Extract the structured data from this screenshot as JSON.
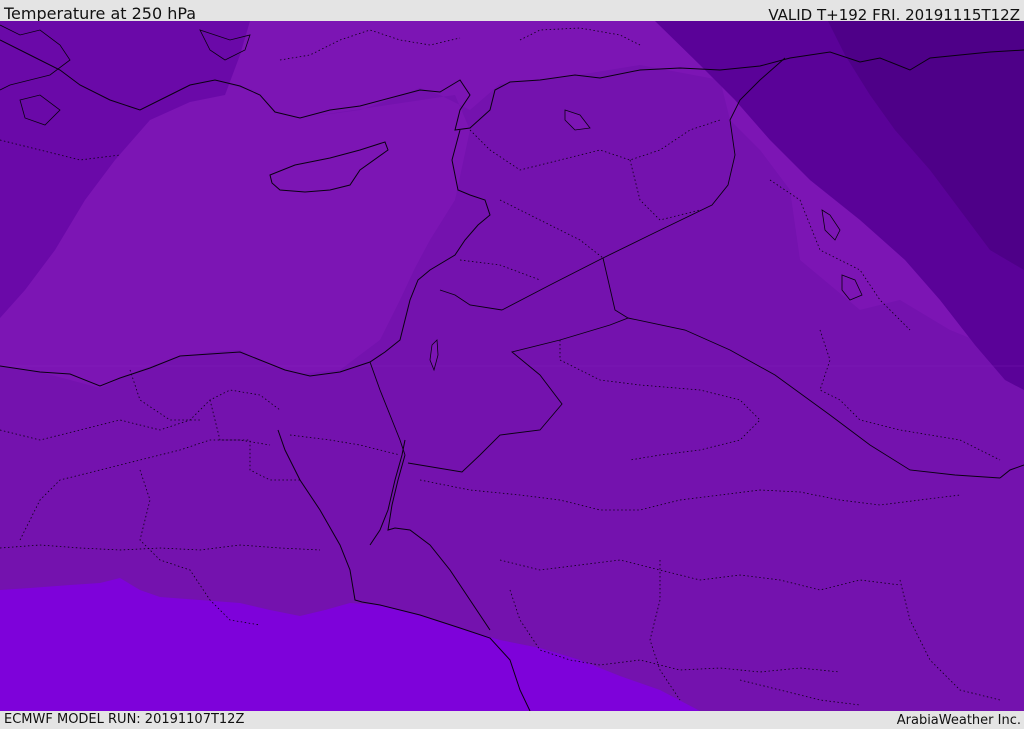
{
  "header": {
    "title": "Temperature at 250 hPa",
    "valid": "VALID T+192 FRI. 20191115T12Z"
  },
  "footer": {
    "model_run": "ECMWF MODEL RUN: 20191107T12Z",
    "credit": "ArabiaWeather Inc."
  },
  "map": {
    "colors": {
      "ocean_band": "#7c15b4",
      "land_band": "#7412ae",
      "cold_band": "#6a09a8",
      "colder_band": "#5a0298",
      "coldest_band": "#4e0088",
      "warm_band": "#7e02da",
      "border": "#0a0012"
    }
  }
}
